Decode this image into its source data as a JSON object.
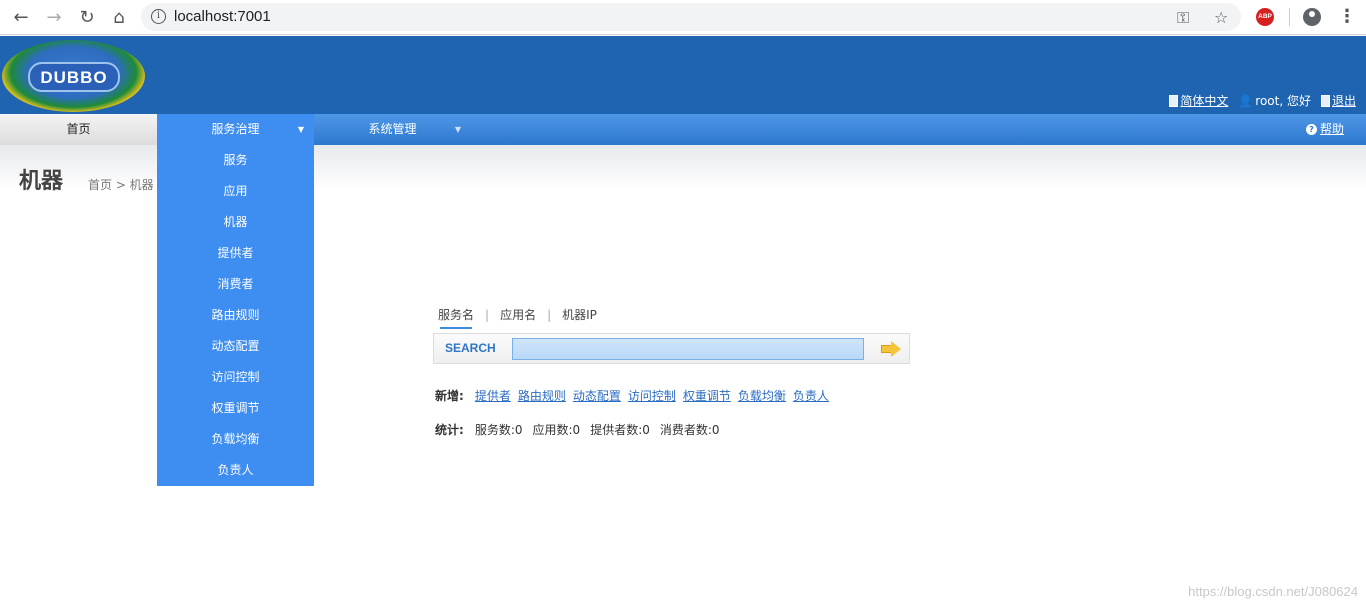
{
  "browser": {
    "url": "localhost:7001"
  },
  "header": {
    "logo_text": "DUBBO",
    "lang_label": "简体中文",
    "user_label": "root, 您好",
    "logout_label": "退出"
  },
  "menu": {
    "home": "首页",
    "service_gov": "服务治理",
    "sys_mgmt": "系统管理",
    "help": "帮助",
    "dropdown": [
      "服务",
      "应用",
      "机器",
      "提供者",
      "消费者",
      "路由规则",
      "动态配置",
      "访问控制",
      "权重调节",
      "负载均衡",
      "负责人"
    ]
  },
  "page": {
    "title": "机器",
    "breadcrumb": "首页 > 机器"
  },
  "search": {
    "tabs": [
      "服务名",
      "应用名",
      "机器IP"
    ],
    "label": "SEARCH",
    "value": ""
  },
  "add": {
    "label": "新增:",
    "links": [
      "提供者",
      "路由规则",
      "动态配置",
      "访问控制",
      "权重调节",
      "负载均衡",
      "负责人"
    ]
  },
  "stats": {
    "label": "统计:",
    "services": "服务数:0",
    "apps": "应用数:0",
    "providers": "提供者数:0",
    "consumers": "消费者数:0"
  },
  "watermark": "https://blog.csdn.net/J080624"
}
